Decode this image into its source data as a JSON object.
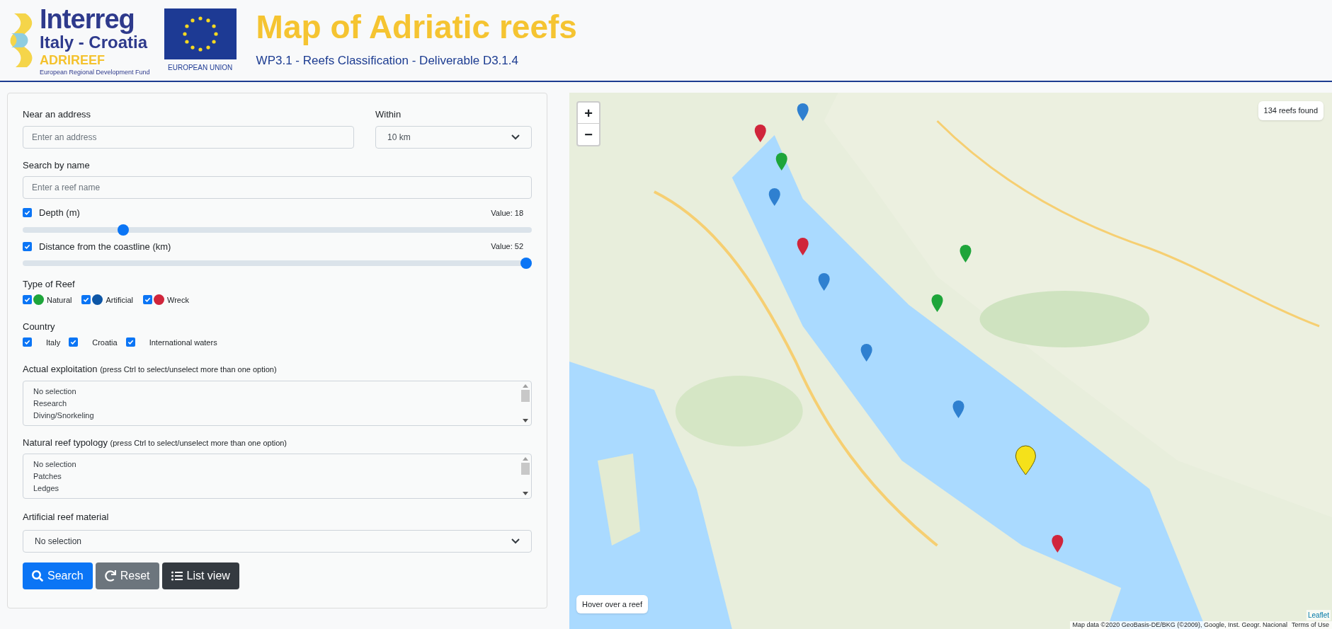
{
  "header": {
    "logo": {
      "name": "Interreg",
      "region": "Italy - Croatia",
      "project": "ADRIREEF",
      "fund": "European Regional Development Fund"
    },
    "eu_label": "EUROPEAN UNION",
    "title": "Map of Adriatic reefs",
    "subtitle": "WP3.1 - Reefs Classification - Deliverable D3.1.4"
  },
  "form": {
    "address": {
      "label": "Near an address",
      "placeholder": "Enter an address"
    },
    "within": {
      "label": "Within",
      "value": "10 km"
    },
    "name": {
      "label": "Search by name",
      "placeholder": "Enter a reef name"
    },
    "sliders": [
      {
        "label": "Depth (m)",
        "checked": true,
        "reading": "Value: 18",
        "level": 0.19
      },
      {
        "label": "Distance from the coastline (km)",
        "checked": true,
        "reading": "Value: 52",
        "level": 1
      }
    ],
    "reef_types": {
      "label": "Type of Reef",
      "items": [
        {
          "label": "Natural",
          "checked": true,
          "color": "#1ea53a"
        },
        {
          "label": "Artificial",
          "checked": true,
          "color": "#0d56a6"
        },
        {
          "label": "Wreck",
          "checked": true,
          "color": "#d0253b"
        }
      ]
    },
    "country": {
      "label": "Country",
      "items": [
        {
          "label": "Italy",
          "checked": true
        },
        {
          "label": "Croatia",
          "checked": true
        },
        {
          "label": "International waters",
          "checked": true
        }
      ]
    },
    "listboxes": [
      {
        "label": "Actual exploitation",
        "hint": "(press Ctrl to select/unselect more than one option)",
        "options": [
          "No selection",
          "Research",
          "Diving/Snorkeling"
        ]
      },
      {
        "label": "Natural reef typology",
        "hint": "(press Ctrl to select/unselect more than one option)",
        "options": [
          "No selection",
          "Patches",
          "Ledges"
        ]
      }
    ],
    "material": {
      "label": "Artificial reef material",
      "value": "No selection"
    },
    "buttons": [
      {
        "kind": "search",
        "label": "Search"
      },
      {
        "kind": "reset",
        "label": "Reset"
      },
      {
        "kind": "list",
        "label": "List view"
      }
    ]
  },
  "map": {
    "zoom_in": "+",
    "zoom_out": "−",
    "count": "134 reefs found",
    "hover_hint": "Hover over a reef",
    "leaflet": "Leaflet",
    "attribution": "Map data ©2020 GeoBasis-DE/BKG (©2009), Google, Inst. Geogr. Nacional",
    "terms": "Terms of Use"
  }
}
